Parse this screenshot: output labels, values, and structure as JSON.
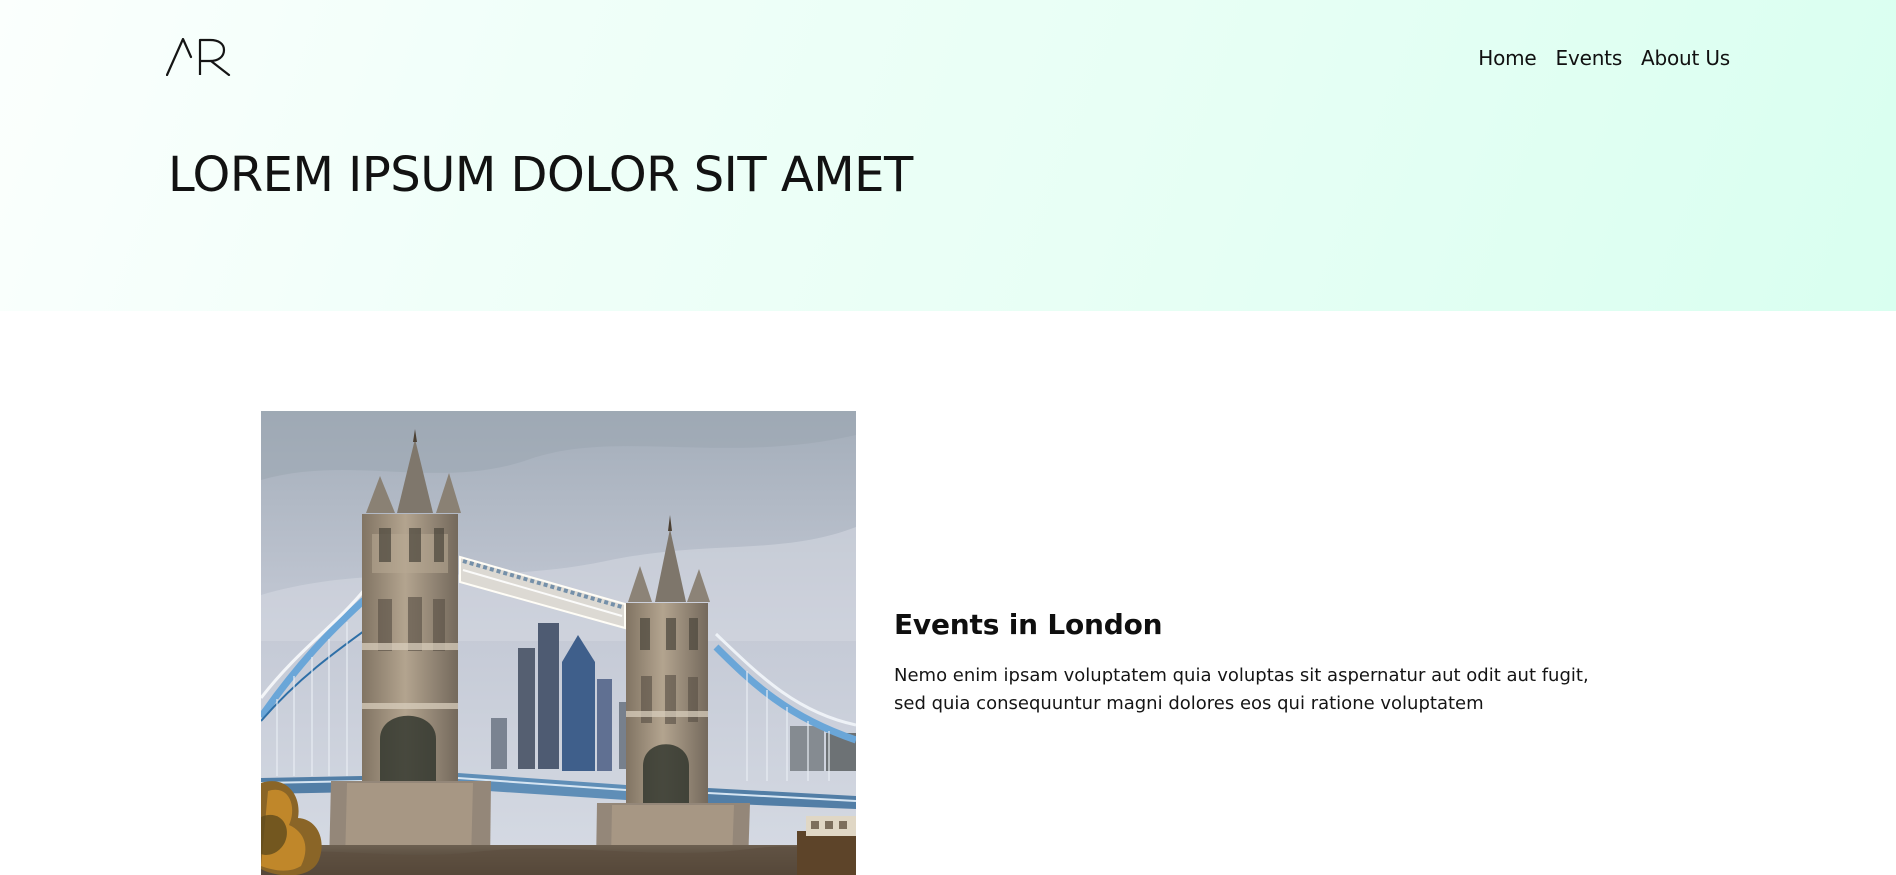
{
  "header": {
    "logo_text": "AR",
    "nav": [
      {
        "label": "Home"
      },
      {
        "label": "Events"
      },
      {
        "label": "About Us"
      }
    ],
    "hero_title": "LOREM IPSUM DOLOR SIT AMET"
  },
  "event_card": {
    "title": "Events in London",
    "description": "Nemo enim ipsam voluptatem quia voluptas sit aspernatur aut odit aut fugit, sed quia consequuntur magni dolores eos qui ratione voluptatem",
    "image_subject": "Tower Bridge"
  },
  "colors": {
    "hero_start": "#fbfffd",
    "hero_end": "#d9fff0",
    "text": "#111111",
    "background": "#ffffff"
  }
}
